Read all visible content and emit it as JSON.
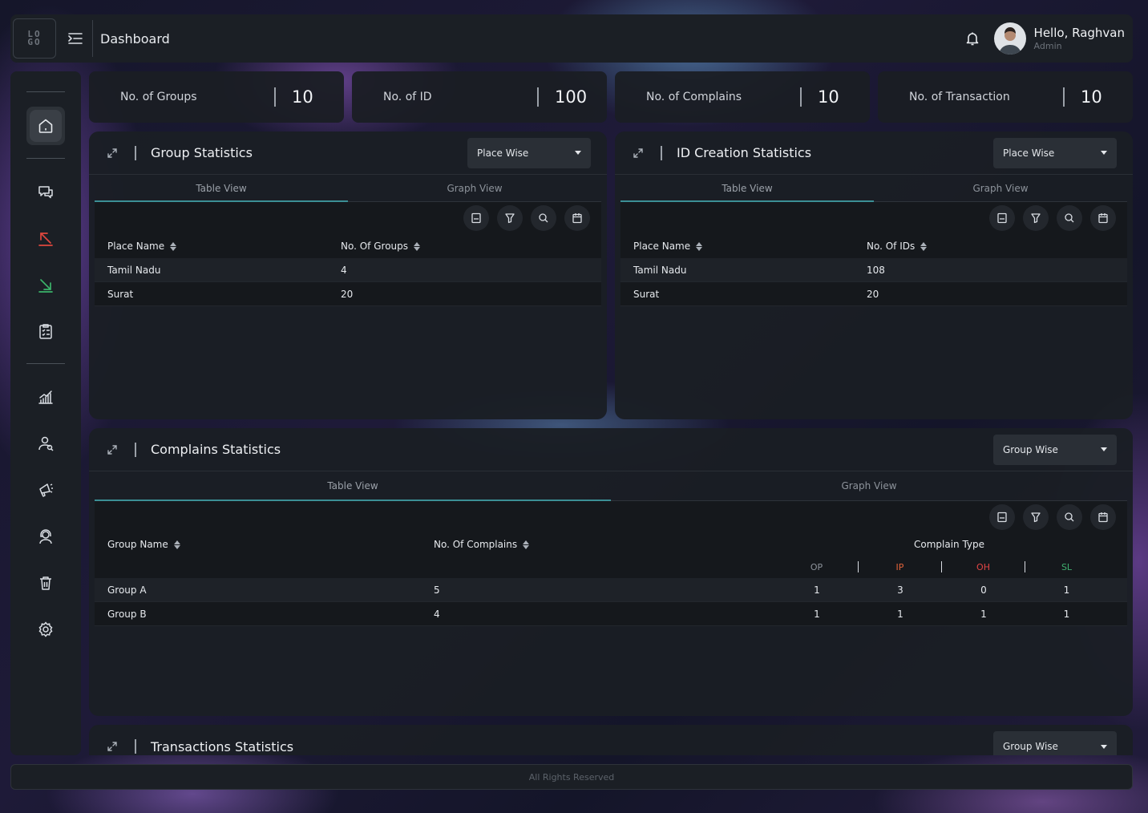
{
  "header": {
    "logo_top": "LO",
    "logo_bottom": "GO",
    "title": "Dashboard",
    "greeting": "Hello, Raghvan",
    "role": "Admin"
  },
  "sidebar": {
    "items": [
      "home-icon",
      "chat-icon",
      "arrow-up-left-icon",
      "arrow-down-right-icon",
      "clipboard-icon",
      "bar-chart-icon",
      "users-icon",
      "megaphone-icon",
      "support-agent-icon",
      "trash-icon",
      "settings-icon"
    ],
    "colors": {
      "outgoing": "#e0473e",
      "incoming": "#3bb36a"
    }
  },
  "stats": [
    {
      "label": "No. of Groups",
      "value": "10"
    },
    {
      "label": "No. of ID",
      "value": "100"
    },
    {
      "label": "No. of Complains",
      "value": "10"
    },
    {
      "label": "No. of Transaction",
      "value": "10"
    }
  ],
  "group_stats": {
    "title": "Group Statistics",
    "dropdown": "Place Wise",
    "tabs": [
      "Table View",
      "Graph View"
    ],
    "columns": [
      "Place Name",
      "No. Of Groups"
    ],
    "rows": [
      [
        "Tamil Nadu",
        "4"
      ],
      [
        "Surat",
        "20"
      ]
    ]
  },
  "id_stats": {
    "title": "ID Creation Statistics",
    "dropdown": "Place Wise",
    "tabs": [
      "Table View",
      "Graph View"
    ],
    "columns": [
      "Place Name",
      "No. Of IDs"
    ],
    "rows": [
      [
        "Tamil Nadu",
        "108"
      ],
      [
        "Surat",
        "20"
      ]
    ]
  },
  "complain_stats": {
    "title": "Complains Statistics",
    "dropdown": "Group Wise",
    "tabs": [
      "Table View",
      "Graph View"
    ],
    "columns": [
      "Group Name",
      "No. Of Complains",
      "Complain Type"
    ],
    "types": [
      {
        "label": "OP",
        "color": "#8d939b"
      },
      {
        "label": "IP",
        "color": "#e0623a"
      },
      {
        "label": "OH",
        "color": "#e04545"
      },
      {
        "label": "SL",
        "color": "#3fae6e"
      }
    ],
    "rows": [
      [
        "Group A",
        "5",
        "1",
        "3",
        "0",
        "1"
      ],
      [
        "Group B",
        "4",
        "1",
        "1",
        "1",
        "1"
      ]
    ]
  },
  "transaction_stats": {
    "title": "Transactions Statistics",
    "dropdown": "Group Wise"
  },
  "footer": {
    "text": "All Rights Reserved"
  },
  "toolbar_icons": [
    "csv-icon",
    "filter-icon",
    "search-icon",
    "calendar-icon"
  ]
}
